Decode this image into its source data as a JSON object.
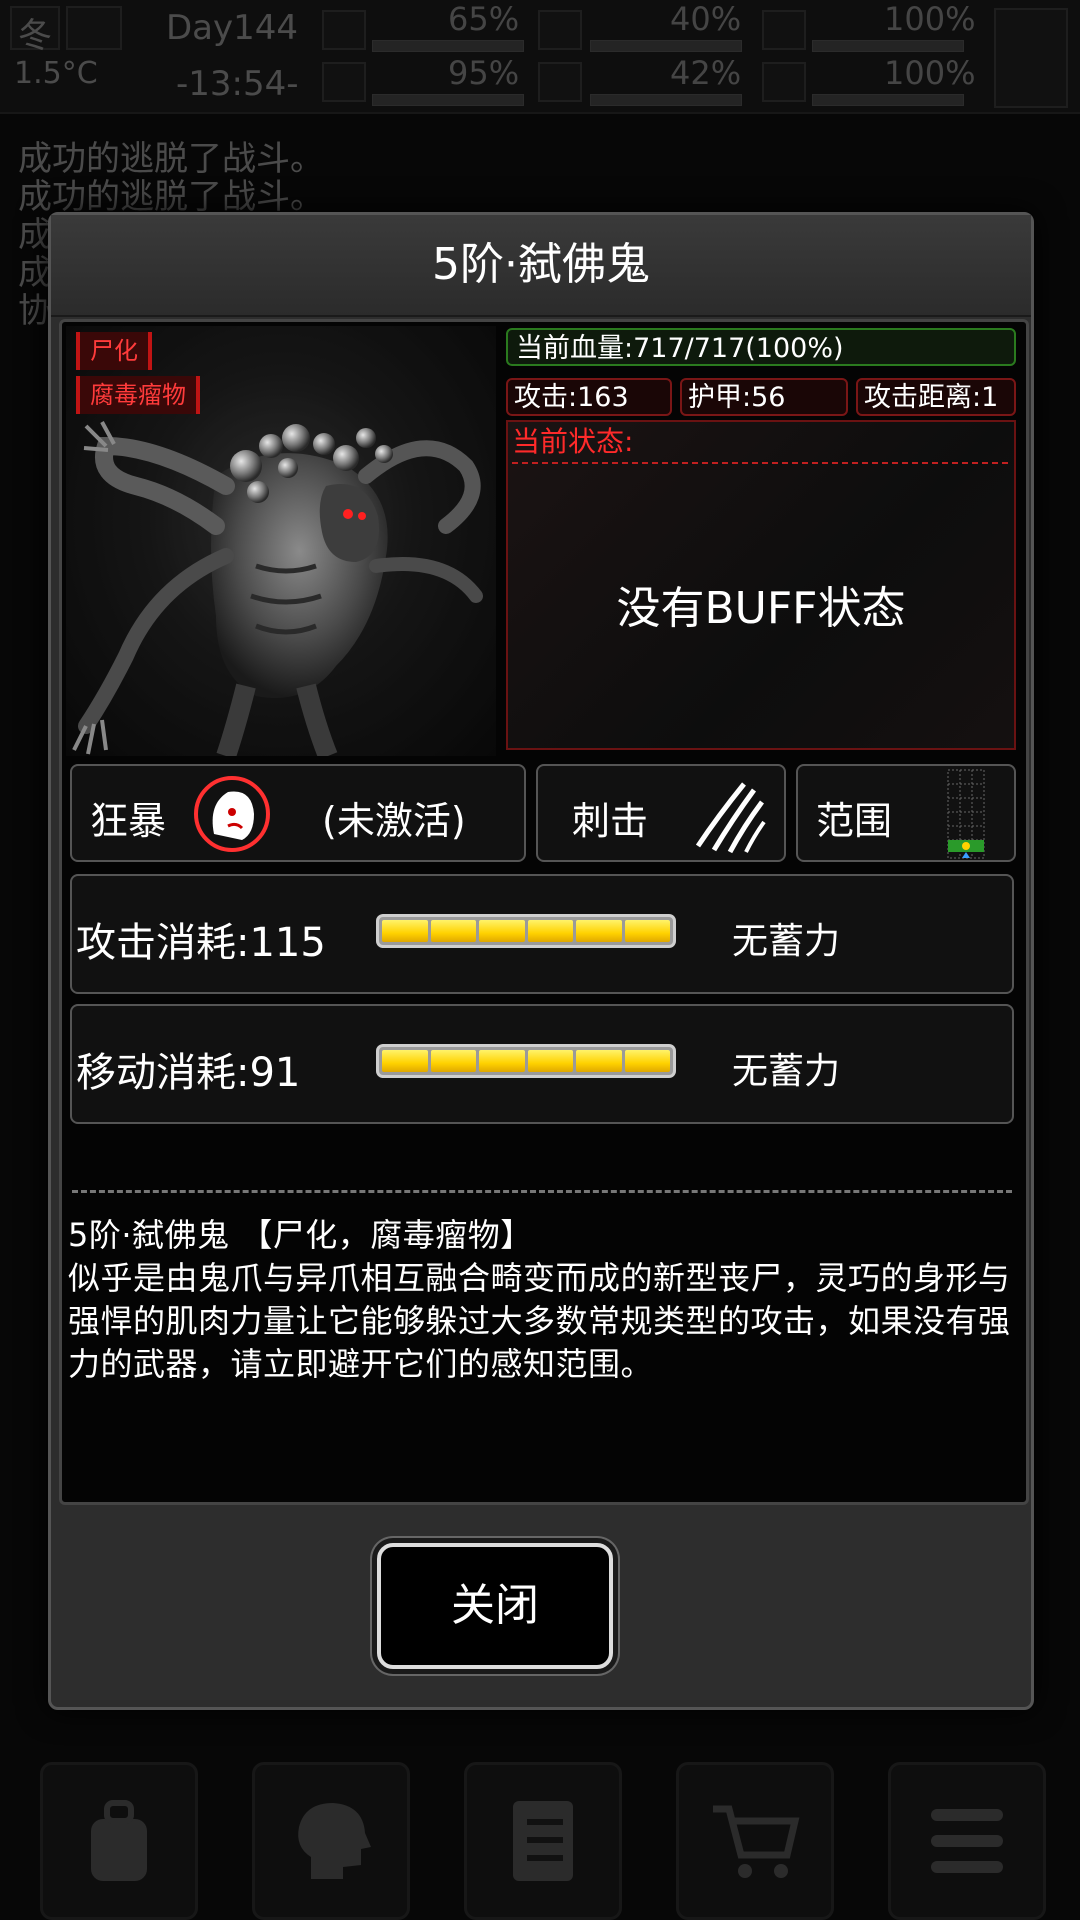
{
  "hud": {
    "season": "冬",
    "temperature": "1.5°C",
    "day": "Day144",
    "time": "-13:54-",
    "stats": [
      "65%",
      "40%",
      "100%",
      "95%",
      "42%",
      "100%"
    ]
  },
  "log": [
    "成功的逃脱了战斗。",
    "成功的逃脱了战斗。",
    "成",
    "成",
    "协"
  ],
  "modal": {
    "title": "5阶·弑佛鬼",
    "tags": [
      "尸化",
      "腐毒瘤物"
    ],
    "hp": "当前血量:717/717(100%)",
    "attack": "攻击:163",
    "armor": "护甲:56",
    "range": "攻击距离:1",
    "status_label": "当前状态:",
    "status_empty": "没有BUFF状态",
    "abilities": {
      "rage_label": "狂暴",
      "rage_state": "(未激活)",
      "stab_label": "刺击",
      "range_label": "范围"
    },
    "attack_cost": "攻击消耗:115",
    "attack_charge": "无蓄力",
    "move_cost": "移动消耗:91",
    "move_charge": "无蓄力",
    "desc_title": "5阶·弑佛鬼 【尸化，腐毒瘤物】",
    "desc_body": "似乎是由鬼爪与异爪相互融合畸变而成的新型丧尸，灵巧的身形与强悍的肌肉力量让它能够躲过大多数常规类型的攻击，如果没有强力的武器，请立即避开它们的感知范围。",
    "close": "关闭"
  },
  "bottom_icons": [
    "backpack-icon",
    "brain-icon",
    "notebook-icon",
    "cart-icon",
    "menu-icon"
  ],
  "colors": {
    "accent_red": "#ff2a2a",
    "hp_green": "#2a7a1e",
    "gauge_yellow": "#ffd200"
  }
}
